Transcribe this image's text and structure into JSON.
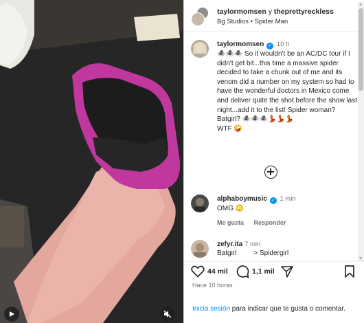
{
  "header": {
    "user1": "taylormomsen",
    "joiner": "y",
    "user2": "theprettyreckless",
    "location": "Bg Studios",
    "separator": "•",
    "audio": "Spider Man"
  },
  "caption": {
    "username": "taylormomsen",
    "verified_mark": "✓",
    "time": "10 h",
    "text_lead": "🕷️🕷️🕷️ So it wouldn't be an AC/DC tour if I didn't get bit...this time a massive spider decided to take a chunk out of me and its venom did a number on my system so had to have the wonderful doctors in Mexico come and deliver quite the shot before the show last night...add it to the list!  Spider woman?  Batgirl? 🕷️🕷️🕷️💃💃💃",
    "text_tail": "WTF 🤪"
  },
  "comments": [
    {
      "username": "alphaboymusic",
      "verified_mark": "✓",
      "time": "1 min",
      "text": "OMG 😳",
      "like_label": "Me gusta",
      "reply_label": "Responder"
    },
    {
      "username": "zefyr.ita",
      "time": "7 min",
      "text": "Batgirl         > Spidergirl"
    }
  ],
  "actions": {
    "likes": "44 mil",
    "comments": "1,1 mil",
    "posted": "Hace 10 horas"
  },
  "login": {
    "link": "Inicia sesión",
    "rest": " para indicar que te gusta o comentar."
  },
  "icons": {
    "like": "heart-icon",
    "comment": "comment-icon",
    "share": "send-icon",
    "save": "bookmark-icon",
    "add": "plus-circle-icon",
    "mute": "muted-speaker-icon",
    "play": "play-icon"
  },
  "colors": {
    "accent": "#0095f6",
    "sock_pink": "#c0389e",
    "sock_black": "#1c1c1c"
  }
}
